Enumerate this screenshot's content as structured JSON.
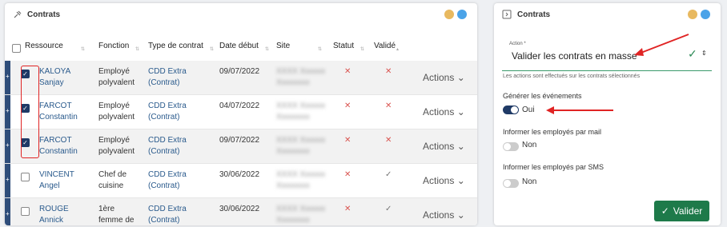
{
  "left_panel": {
    "title": "Contrats",
    "icon": "gavel-icon",
    "dot_colors": [
      "#e8b960",
      "#4ba3e8"
    ]
  },
  "table": {
    "columns": [
      "Ressource",
      "Fonction",
      "Type de contrat",
      "Date début",
      "Site",
      "Statut",
      "Validé"
    ],
    "rows": [
      {
        "first": "KALOYA",
        "last": "Sanjay",
        "fonction1": "Employé",
        "fonction2": "polyvalent",
        "type1": "CDD Extra",
        "type2": "(Contrat)",
        "date": "09/07/2022",
        "site1": "XXXX Xxxxxx",
        "site2": "Xxxxxxxx",
        "statut": "✕",
        "valide": "✕",
        "actions": "Actions",
        "checked": true
      },
      {
        "first": "FARCOT",
        "last": "Constantin",
        "fonction1": "Employé",
        "fonction2": "polyvalent",
        "type1": "CDD Extra",
        "type2": "(Contrat)",
        "date": "04/07/2022",
        "site1": "XXXX Xxxxxx",
        "site2": "Xxxxxxxx",
        "statut": "✕",
        "valide": "✕",
        "actions": "Actions",
        "checked": true
      },
      {
        "first": "FARCOT",
        "last": "Constantin",
        "fonction1": "Employé",
        "fonction2": "polyvalent",
        "type1": "CDD Extra",
        "type2": "(Contrat)",
        "date": "09/07/2022",
        "site1": "XXXX Xxxxxx",
        "site2": "Xxxxxxxx",
        "statut": "✕",
        "valide": "✕",
        "actions": "Actions",
        "checked": true
      },
      {
        "first": "VINCENT",
        "last": "Angel",
        "fonction1": "Chef de",
        "fonction2": "cuisine",
        "type1": "CDD Extra",
        "type2": "(Contrat)",
        "date": "30/06/2022",
        "site1": "XXXX Xxxxxx",
        "site2": "Xxxxxxxx",
        "statut": "✕",
        "valide": "✓",
        "actions": "Actions",
        "checked": false
      },
      {
        "first": "ROUGE",
        "last": "Annick",
        "fonction1": "1ère",
        "fonction2": "femme de",
        "type1": "CDD Extra",
        "type2": "(Contrat)",
        "date": "30/06/2022",
        "site1": "XXXX Xxxxxx",
        "site2": "Xxxxxxxx",
        "statut": "✕",
        "valide": "✓",
        "actions": "Actions",
        "checked": false
      }
    ]
  },
  "right_panel": {
    "title": "Contrats",
    "icon": "panel-icon",
    "action_label": "Action *",
    "action_value": "Valider les contrats en masse",
    "help_text": "Les actions sont effectués sur les contrats sélectionnés",
    "events_label": "Générer les événements",
    "events_value": "Oui",
    "mail_label": "Informer les employés par mail",
    "mail_value": "Non",
    "sms_label": "Informer les employés par SMS",
    "sms_value": "Non",
    "submit_label": "Valider"
  }
}
